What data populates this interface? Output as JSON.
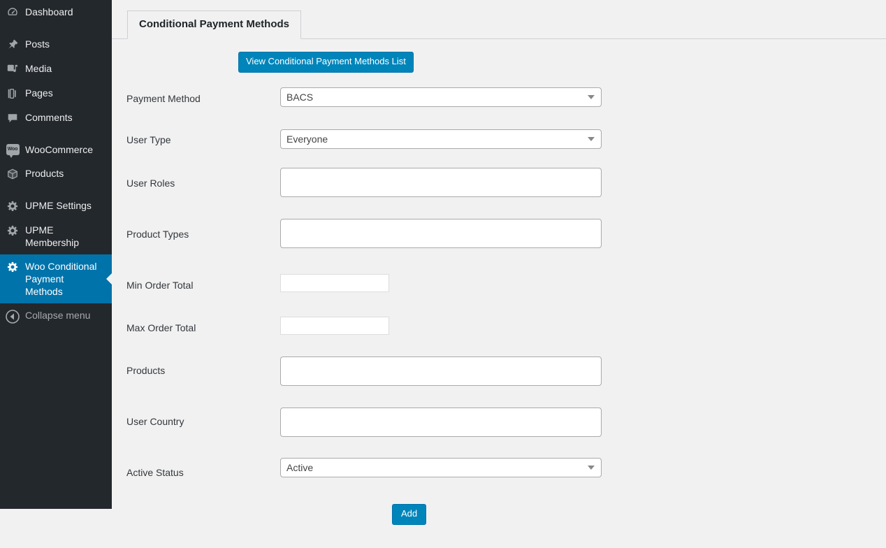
{
  "sidebar": {
    "items": [
      {
        "label": "Dashboard",
        "icon": "dashboard-icon",
        "current": false,
        "gap": false
      },
      {
        "label": "Posts",
        "icon": "pin-icon",
        "current": false,
        "gap": true
      },
      {
        "label": "Media",
        "icon": "media-icon",
        "current": false,
        "gap": false
      },
      {
        "label": "Pages",
        "icon": "pages-icon",
        "current": false,
        "gap": false
      },
      {
        "label": "Comments",
        "icon": "comment-bubble-icon",
        "current": false,
        "gap": false
      },
      {
        "label": "WooCommerce",
        "icon": "woocommerce-icon",
        "current": false,
        "gap": true
      },
      {
        "label": "Products",
        "icon": "box-icon",
        "current": false,
        "gap": false
      },
      {
        "label": "UPME Settings",
        "icon": "gear-icon",
        "current": false,
        "gap": true
      },
      {
        "label": "UPME Membership",
        "icon": "gear-icon",
        "current": false,
        "gap": false
      },
      {
        "label": "Woo Conditional Payment Methods",
        "icon": "gear-icon",
        "current": true,
        "gap": false
      }
    ],
    "collapse": {
      "label": "Collapse menu",
      "icon": "collapse-arrow-icon"
    },
    "woo_badge_text": "Woo"
  },
  "colors": {
    "sidebar_bg": "#23282d",
    "accent_blue": "#0085ba",
    "current_item_bg": "#0073aa",
    "content_bg": "#f1f1f1",
    "border_gray": "#ccd0d4"
  },
  "tabs": [
    {
      "label": "Conditional Payment Methods",
      "active": true
    }
  ],
  "toolbar": {
    "view_list_label": "View Conditional Payment Methods List"
  },
  "form": {
    "rows": [
      {
        "label": "Payment Method",
        "type": "select",
        "value": "BACS",
        "placeholder": ""
      },
      {
        "label": "User Type",
        "type": "select",
        "value": "Everyone",
        "placeholder": ""
      },
      {
        "label": "User Roles",
        "type": "tags",
        "value": "",
        "placeholder": ""
      },
      {
        "label": "Product Types",
        "type": "tags",
        "value": "",
        "placeholder": ""
      },
      {
        "label": "Min Order Total",
        "type": "text-small",
        "value": "",
        "placeholder": ""
      },
      {
        "label": "Max Order Total",
        "type": "text-small",
        "value": "",
        "placeholder": ""
      },
      {
        "label": "Products",
        "type": "tags",
        "value": "",
        "placeholder": ""
      },
      {
        "label": "User Country",
        "type": "tags",
        "value": "",
        "placeholder": ""
      },
      {
        "label": "Active Status",
        "type": "select",
        "value": "Active",
        "placeholder": ""
      }
    ],
    "submit_label": "Add"
  }
}
